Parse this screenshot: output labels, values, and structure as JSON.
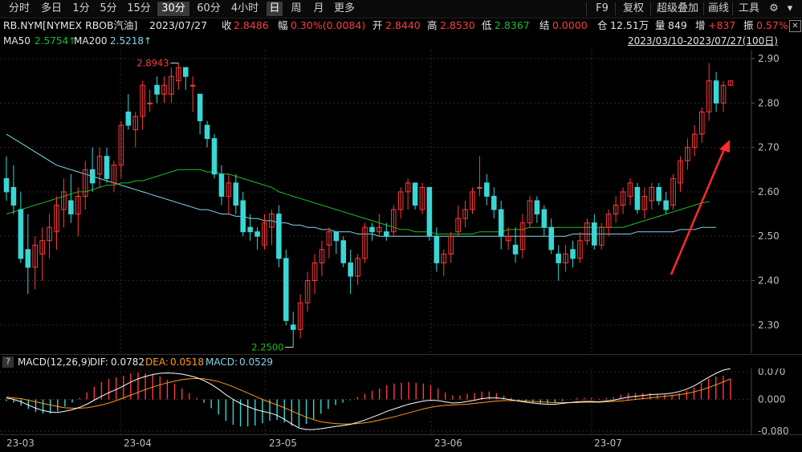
{
  "toolbar": {
    "periods": [
      "分时",
      "多日",
      "1分",
      "5分",
      "15分",
      "30分",
      "60分",
      "4小时",
      "日",
      "周",
      "月",
      "更多"
    ],
    "active_periods": [
      "30分",
      "日"
    ],
    "right_items": [
      "F9",
      "复权",
      "超级叠加",
      "画线",
      "工具"
    ]
  },
  "info": {
    "symbol": "RB.NYM[NYMEX RBOB汽油]",
    "date": "2023/07/27",
    "close_label": "收",
    "close_value": "2.8486",
    "amp_label": "幅",
    "amp_value": "0.30%(0.0084)",
    "open_label": "开",
    "open_value": "2.8440",
    "high_label": "高",
    "high_value": "2.8530",
    "low_label": "低",
    "low_value": "2.8367",
    "settle_label": "结",
    "settle_value": "0.0000",
    "oi_label": "仓",
    "oi_value": "12.51万",
    "vol_label": "量",
    "vol_value": "849",
    "inc_label": "增",
    "inc_value": "+837",
    "swing_label": "振",
    "swing_value": "0.57%"
  },
  "ma": {
    "ma50_label": "MA50",
    "ma50_value": "2.5754↑",
    "ma200_label": "MA200",
    "ma200_value": "2.5218↑",
    "range": "2023/03/10-2023/07/27(100日)"
  },
  "price_axis": {
    "ticks": [
      "2.90",
      "2.80",
      "2.70",
      "2.60",
      "2.50",
      "2.40",
      "2.30"
    ]
  },
  "annotations": {
    "high_label": "2.8943",
    "low_label": "2.2500"
  },
  "macd": {
    "help": "?",
    "title": "MACD(12,26,9)",
    "dif_label": "DIF:",
    "dif_value": "0.0782",
    "dea_label": "DEA:",
    "dea_value": "0.0518",
    "macd_label": "MACD:",
    "macd_value": "0.0529",
    "ticks": [
      "0.070",
      "0.000",
      "-0.080"
    ]
  },
  "xaxis": {
    "labels": [
      "23-03",
      "23-04",
      "23-05",
      "23-06",
      "23-07"
    ]
  },
  "colors": {
    "up": "#ff3b3b",
    "down": "#3ad6d6",
    "ma50": "#1fbf1f",
    "ma200": "#7fd8e6",
    "dif": "#ffffff",
    "dea": "#ff9a1f",
    "arrow": "#ff2a2a"
  },
  "chart_data": {
    "type": "candlestick",
    "ylim": [
      2.24,
      2.92
    ],
    "candles": [
      {
        "o": 2.63,
        "h": 2.68,
        "l": 2.58,
        "c": 2.6
      },
      {
        "o": 2.61,
        "h": 2.66,
        "l": 2.55,
        "c": 2.57
      },
      {
        "o": 2.56,
        "h": 2.6,
        "l": 2.44,
        "c": 2.45
      },
      {
        "o": 2.47,
        "h": 2.55,
        "l": 2.37,
        "c": 2.43
      },
      {
        "o": 2.43,
        "h": 2.5,
        "l": 2.38,
        "c": 2.48
      },
      {
        "o": 2.46,
        "h": 2.52,
        "l": 2.4,
        "c": 2.49
      },
      {
        "o": 2.49,
        "h": 2.55,
        "l": 2.45,
        "c": 2.52
      },
      {
        "o": 2.51,
        "h": 2.59,
        "l": 2.47,
        "c": 2.57
      },
      {
        "o": 2.56,
        "h": 2.63,
        "l": 2.52,
        "c": 2.6
      },
      {
        "o": 2.58,
        "h": 2.64,
        "l": 2.53,
        "c": 2.55
      },
      {
        "o": 2.55,
        "h": 2.61,
        "l": 2.5,
        "c": 2.59
      },
      {
        "o": 2.59,
        "h": 2.67,
        "l": 2.56,
        "c": 2.65
      },
      {
        "o": 2.65,
        "h": 2.7,
        "l": 2.6,
        "c": 2.62
      },
      {
        "o": 2.64,
        "h": 2.7,
        "l": 2.61,
        "c": 2.68
      },
      {
        "o": 2.68,
        "h": 2.7,
        "l": 2.62,
        "c": 2.63
      },
      {
        "o": 2.62,
        "h": 2.67,
        "l": 2.6,
        "c": 2.66
      },
      {
        "o": 2.66,
        "h": 2.76,
        "l": 2.63,
        "c": 2.75
      },
      {
        "o": 2.78,
        "h": 2.82,
        "l": 2.74,
        "c": 2.75
      },
      {
        "o": 2.74,
        "h": 2.78,
        "l": 2.7,
        "c": 2.77
      },
      {
        "o": 2.77,
        "h": 2.85,
        "l": 2.74,
        "c": 2.84
      },
      {
        "o": 2.8,
        "h": 2.83,
        "l": 2.78,
        "c": 2.8
      },
      {
        "o": 2.84,
        "h": 2.86,
        "l": 2.8,
        "c": 2.82
      },
      {
        "o": 2.82,
        "h": 2.86,
        "l": 2.8,
        "c": 2.84
      },
      {
        "o": 2.82,
        "h": 2.88,
        "l": 2.8,
        "c": 2.86
      },
      {
        "o": 2.85,
        "h": 2.89,
        "l": 2.83,
        "c": 2.88
      },
      {
        "o": 2.88,
        "h": 2.88,
        "l": 2.83,
        "c": 2.86
      },
      {
        "o": 2.84,
        "h": 2.86,
        "l": 2.78,
        "c": 2.84
      },
      {
        "o": 2.82,
        "h": 2.82,
        "l": 2.73,
        "c": 2.76
      },
      {
        "o": 2.75,
        "h": 2.76,
        "l": 2.7,
        "c": 2.72
      },
      {
        "o": 2.72,
        "h": 2.73,
        "l": 2.63,
        "c": 2.64
      },
      {
        "o": 2.64,
        "h": 2.66,
        "l": 2.57,
        "c": 2.59
      },
      {
        "o": 2.59,
        "h": 2.64,
        "l": 2.55,
        "c": 2.62
      },
      {
        "o": 2.62,
        "h": 2.64,
        "l": 2.55,
        "c": 2.57
      },
      {
        "o": 2.58,
        "h": 2.6,
        "l": 2.5,
        "c": 2.51
      },
      {
        "o": 2.52,
        "h": 2.55,
        "l": 2.49,
        "c": 2.51
      },
      {
        "o": 2.51,
        "h": 2.52,
        "l": 2.47,
        "c": 2.5
      },
      {
        "o": 2.48,
        "h": 2.55,
        "l": 2.47,
        "c": 2.53
      },
      {
        "o": 2.52,
        "h": 2.56,
        "l": 2.48,
        "c": 2.55
      },
      {
        "o": 2.55,
        "h": 2.57,
        "l": 2.43,
        "c": 2.45
      },
      {
        "o": 2.45,
        "h": 2.47,
        "l": 2.3,
        "c": 2.31
      },
      {
        "o": 2.3,
        "h": 2.33,
        "l": 2.25,
        "c": 2.29
      },
      {
        "o": 2.29,
        "h": 2.37,
        "l": 2.27,
        "c": 2.35
      },
      {
        "o": 2.35,
        "h": 2.42,
        "l": 2.33,
        "c": 2.4
      },
      {
        "o": 2.4,
        "h": 2.46,
        "l": 2.37,
        "c": 2.44
      },
      {
        "o": 2.44,
        "h": 2.49,
        "l": 2.41,
        "c": 2.47
      },
      {
        "o": 2.48,
        "h": 2.52,
        "l": 2.45,
        "c": 2.51
      },
      {
        "o": 2.51,
        "h": 2.51,
        "l": 2.46,
        "c": 2.49
      },
      {
        "o": 2.49,
        "h": 2.5,
        "l": 2.43,
        "c": 2.44
      },
      {
        "o": 2.44,
        "h": 2.47,
        "l": 2.37,
        "c": 2.41
      },
      {
        "o": 2.41,
        "h": 2.46,
        "l": 2.39,
        "c": 2.45
      },
      {
        "o": 2.45,
        "h": 2.53,
        "l": 2.44,
        "c": 2.52
      },
      {
        "o": 2.52,
        "h": 2.53,
        "l": 2.49,
        "c": 2.51
      },
      {
        "o": 2.51,
        "h": 2.55,
        "l": 2.5,
        "c": 2.52
      },
      {
        "o": 2.51,
        "h": 2.53,
        "l": 2.49,
        "c": 2.5
      },
      {
        "o": 2.51,
        "h": 2.57,
        "l": 2.5,
        "c": 2.56
      },
      {
        "o": 2.56,
        "h": 2.61,
        "l": 2.54,
        "c": 2.6
      },
      {
        "o": 2.6,
        "h": 2.63,
        "l": 2.56,
        "c": 2.62
      },
      {
        "o": 2.62,
        "h": 2.62,
        "l": 2.56,
        "c": 2.57
      },
      {
        "o": 2.56,
        "h": 2.62,
        "l": 2.55,
        "c": 2.61
      },
      {
        "o": 2.61,
        "h": 2.61,
        "l": 2.49,
        "c": 2.5
      },
      {
        "o": 2.5,
        "h": 2.52,
        "l": 2.42,
        "c": 2.44
      },
      {
        "o": 2.44,
        "h": 2.47,
        "l": 2.41,
        "c": 2.46
      },
      {
        "o": 2.46,
        "h": 2.51,
        "l": 2.44,
        "c": 2.5
      },
      {
        "o": 2.51,
        "h": 2.57,
        "l": 2.5,
        "c": 2.54
      },
      {
        "o": 2.54,
        "h": 2.58,
        "l": 2.52,
        "c": 2.56
      },
      {
        "o": 2.56,
        "h": 2.61,
        "l": 2.55,
        "c": 2.6
      },
      {
        "o": 2.61,
        "h": 2.68,
        "l": 2.59,
        "c": 2.61
      },
      {
        "o": 2.62,
        "h": 2.64,
        "l": 2.57,
        "c": 2.59
      },
      {
        "o": 2.59,
        "h": 2.61,
        "l": 2.54,
        "c": 2.56
      },
      {
        "o": 2.56,
        "h": 2.58,
        "l": 2.47,
        "c": 2.5
      },
      {
        "o": 2.49,
        "h": 2.52,
        "l": 2.47,
        "c": 2.5
      },
      {
        "o": 2.48,
        "h": 2.52,
        "l": 2.44,
        "c": 2.46
      },
      {
        "o": 2.47,
        "h": 2.55,
        "l": 2.45,
        "c": 2.53
      },
      {
        "o": 2.53,
        "h": 2.59,
        "l": 2.52,
        "c": 2.58
      },
      {
        "o": 2.58,
        "h": 2.59,
        "l": 2.53,
        "c": 2.55
      },
      {
        "o": 2.56,
        "h": 2.57,
        "l": 2.5,
        "c": 2.52
      },
      {
        "o": 2.52,
        "h": 2.54,
        "l": 2.46,
        "c": 2.47
      },
      {
        "o": 2.46,
        "h": 2.48,
        "l": 2.4,
        "c": 2.44
      },
      {
        "o": 2.44,
        "h": 2.48,
        "l": 2.42,
        "c": 2.46
      },
      {
        "o": 2.47,
        "h": 2.49,
        "l": 2.43,
        "c": 2.45
      },
      {
        "o": 2.45,
        "h": 2.51,
        "l": 2.44,
        "c": 2.49
      },
      {
        "o": 2.49,
        "h": 2.54,
        "l": 2.48,
        "c": 2.53
      },
      {
        "o": 2.53,
        "h": 2.55,
        "l": 2.47,
        "c": 2.48
      },
      {
        "o": 2.48,
        "h": 2.53,
        "l": 2.47,
        "c": 2.52
      },
      {
        "o": 2.52,
        "h": 2.56,
        "l": 2.5,
        "c": 2.55
      },
      {
        "o": 2.55,
        "h": 2.59,
        "l": 2.53,
        "c": 2.57
      },
      {
        "o": 2.57,
        "h": 2.61,
        "l": 2.55,
        "c": 2.6
      },
      {
        "o": 2.59,
        "h": 2.63,
        "l": 2.57,
        "c": 2.62
      },
      {
        "o": 2.61,
        "h": 2.62,
        "l": 2.55,
        "c": 2.56
      },
      {
        "o": 2.56,
        "h": 2.61,
        "l": 2.54,
        "c": 2.59
      },
      {
        "o": 2.58,
        "h": 2.62,
        "l": 2.56,
        "c": 2.61
      },
      {
        "o": 2.61,
        "h": 2.62,
        "l": 2.57,
        "c": 2.58
      },
      {
        "o": 2.58,
        "h": 2.6,
        "l": 2.55,
        "c": 2.56
      },
      {
        "o": 2.57,
        "h": 2.64,
        "l": 2.56,
        "c": 2.63
      },
      {
        "o": 2.62,
        "h": 2.68,
        "l": 2.6,
        "c": 2.67
      },
      {
        "o": 2.67,
        "h": 2.72,
        "l": 2.65,
        "c": 2.7
      },
      {
        "o": 2.7,
        "h": 2.75,
        "l": 2.68,
        "c": 2.73
      },
      {
        "o": 2.73,
        "h": 2.79,
        "l": 2.71,
        "c": 2.78
      },
      {
        "o": 2.78,
        "h": 2.89,
        "l": 2.76,
        "c": 2.85
      },
      {
        "o": 2.85,
        "h": 2.87,
        "l": 2.78,
        "c": 2.8
      },
      {
        "o": 2.8,
        "h": 2.85,
        "l": 2.78,
        "c": 2.84
      },
      {
        "o": 2.84,
        "h": 2.85,
        "l": 2.84,
        "c": 2.85
      }
    ],
    "ma50": [
      2.55,
      2.555,
      2.56,
      2.565,
      2.57,
      2.575,
      2.58,
      2.585,
      2.59,
      2.595,
      2.6,
      2.6,
      2.605,
      2.61,
      2.615,
      2.615,
      2.62,
      2.62,
      2.625,
      2.625,
      2.63,
      2.635,
      2.64,
      2.645,
      2.65,
      2.65,
      2.65,
      2.65,
      2.645,
      2.645,
      2.64,
      2.64,
      2.635,
      2.63,
      2.625,
      2.62,
      2.615,
      2.61,
      2.6,
      2.595,
      2.59,
      2.585,
      2.58,
      2.575,
      2.57,
      2.565,
      2.56,
      2.555,
      2.55,
      2.545,
      2.54,
      2.535,
      2.53,
      2.525,
      2.52,
      2.515,
      2.515,
      2.51,
      2.51,
      2.51,
      2.505,
      2.505,
      2.505,
      2.505,
      2.505,
      2.505,
      2.51,
      2.51,
      2.51,
      2.51,
      2.515,
      2.515,
      2.515,
      2.52,
      2.52,
      2.52,
      2.52,
      2.52,
      2.52,
      2.52,
      2.52,
      2.52,
      2.52,
      2.52,
      2.52,
      2.52,
      2.52,
      2.525,
      2.53,
      2.535,
      2.54,
      2.545,
      2.55,
      2.555,
      2.56,
      2.565,
      2.57,
      2.575,
      2.578
    ],
    "ma200": [
      2.73,
      2.72,
      2.71,
      2.7,
      2.69,
      2.68,
      2.67,
      2.66,
      2.655,
      2.65,
      2.645,
      2.64,
      2.635,
      2.63,
      2.625,
      2.62,
      2.615,
      2.61,
      2.605,
      2.6,
      2.595,
      2.59,
      2.585,
      2.58,
      2.575,
      2.57,
      2.565,
      2.56,
      2.56,
      2.555,
      2.55,
      2.55,
      2.545,
      2.545,
      2.54,
      2.54,
      2.535,
      2.535,
      2.53,
      2.53,
      2.525,
      2.525,
      2.52,
      2.52,
      2.515,
      2.515,
      2.51,
      2.51,
      2.51,
      2.505,
      2.505,
      2.505,
      2.5,
      2.5,
      2.5,
      2.5,
      2.5,
      2.5,
      2.5,
      2.5,
      2.5,
      2.5,
      2.5,
      2.5,
      2.5,
      2.5,
      2.5,
      2.5,
      2.5,
      2.5,
      2.5,
      2.5,
      2.5,
      2.5,
      2.5,
      2.5,
      2.5,
      2.5,
      2.5,
      2.505,
      2.505,
      2.505,
      2.505,
      2.505,
      2.505,
      2.505,
      2.505,
      2.505,
      2.51,
      2.51,
      2.51,
      2.51,
      2.51,
      2.51,
      2.515,
      2.515,
      2.515,
      2.52,
      2.52,
      2.52
    ],
    "macd_ylim": [
      -0.08,
      0.07
    ],
    "dif": [
      0.004,
      0.0,
      -0.006,
      -0.014,
      -0.022,
      -0.028,
      -0.032,
      -0.033,
      -0.03,
      -0.026,
      -0.02,
      -0.012,
      -0.002,
      0.008,
      0.017,
      0.025,
      0.034,
      0.044,
      0.052,
      0.058,
      0.063,
      0.066,
      0.067,
      0.066,
      0.064,
      0.06,
      0.055,
      0.048,
      0.038,
      0.026,
      0.012,
      0.0,
      -0.01,
      -0.018,
      -0.025,
      -0.03,
      -0.034,
      -0.04,
      -0.05,
      -0.062,
      -0.072,
      -0.076,
      -0.076,
      -0.074,
      -0.071,
      -0.068,
      -0.066,
      -0.063,
      -0.058,
      -0.052,
      -0.045,
      -0.038,
      -0.03,
      -0.024,
      -0.018,
      -0.012,
      -0.008,
      -0.004,
      -0.002,
      -0.003,
      -0.006,
      -0.009,
      -0.008,
      -0.005,
      -0.002,
      0.002,
      0.004,
      0.004,
      0.002,
      -0.001,
      -0.004,
      -0.007,
      -0.009,
      -0.011,
      -0.012,
      -0.012,
      -0.01,
      -0.008,
      -0.006,
      -0.005,
      -0.005,
      -0.006,
      -0.004,
      -0.002,
      0.002,
      0.006,
      0.008,
      0.01,
      0.012,
      0.013,
      0.014,
      0.016,
      0.02,
      0.026,
      0.034,
      0.045,
      0.056,
      0.066,
      0.074,
      0.078
    ],
    "dea": [
      0.006,
      0.004,
      0.002,
      -0.002,
      -0.006,
      -0.01,
      -0.014,
      -0.018,
      -0.021,
      -0.022,
      -0.022,
      -0.021,
      -0.018,
      -0.014,
      -0.009,
      -0.003,
      0.004,
      0.011,
      0.018,
      0.025,
      0.031,
      0.037,
      0.042,
      0.046,
      0.05,
      0.052,
      0.053,
      0.052,
      0.049,
      0.045,
      0.039,
      0.032,
      0.024,
      0.016,
      0.008,
      0.0,
      -0.007,
      -0.014,
      -0.021,
      -0.029,
      -0.037,
      -0.045,
      -0.051,
      -0.056,
      -0.059,
      -0.061,
      -0.062,
      -0.062,
      -0.061,
      -0.059,
      -0.056,
      -0.052,
      -0.048,
      -0.044,
      -0.039,
      -0.034,
      -0.029,
      -0.024,
      -0.02,
      -0.017,
      -0.015,
      -0.014,
      -0.013,
      -0.012,
      -0.01,
      -0.008,
      -0.006,
      -0.004,
      -0.003,
      -0.003,
      -0.003,
      -0.004,
      -0.005,
      -0.006,
      -0.007,
      -0.008,
      -0.008,
      -0.008,
      -0.008,
      -0.007,
      -0.007,
      -0.007,
      -0.006,
      -0.005,
      -0.004,
      -0.002,
      0.0,
      0.002,
      0.004,
      0.006,
      0.008,
      0.01,
      0.012,
      0.015,
      0.019,
      0.024,
      0.03,
      0.037,
      0.044,
      0.052
    ],
    "macd_hist_from": "2*(dif-dea)"
  }
}
